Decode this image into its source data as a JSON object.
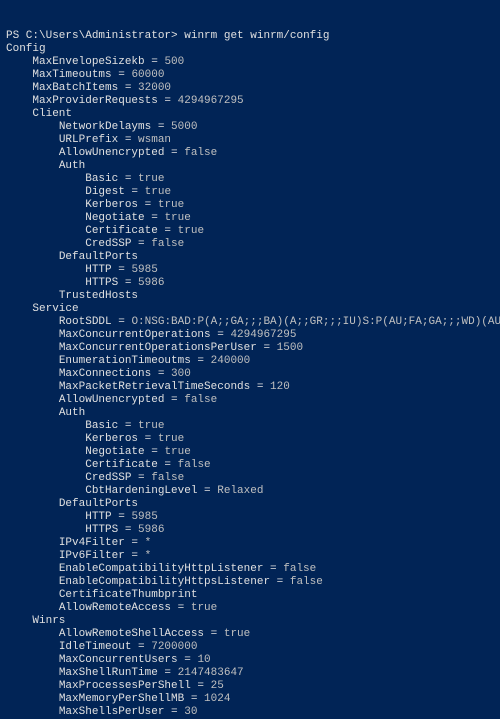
{
  "prompt": "PS C:\\Users\\Administrator>",
  "command": "winrm get winrm/config",
  "root": "Config",
  "config": {
    "MaxEnvelopeSizekb": "500",
    "MaxTimeoutms": "60000",
    "MaxBatchItems": "32000",
    "MaxProviderRequests": "4294967295"
  },
  "client_label": "Client",
  "client": {
    "NetworkDelayms": "5000",
    "URLPrefix": "wsman",
    "AllowUnencrypted": "false"
  },
  "client_auth_label": "Auth",
  "client_auth": {
    "Basic": "true",
    "Digest": "true",
    "Kerberos": "true",
    "Negotiate": "true",
    "Certificate": "true",
    "CredSSP": "false"
  },
  "client_ports_label": "DefaultPorts",
  "client_ports": {
    "HTTP": "5985",
    "HTTPS": "5986"
  },
  "client_trusted_label": "TrustedHosts",
  "service_label": "Service",
  "service": {
    "RootSDDL": "O:NSG:BAD:P(A;;GA;;;BA)(A;;GR;;;IU)S:P(AU;FA;GA;;;WD)(AU;SA;GXGW;;;WD)",
    "MaxConcurrentOperations": "4294967295",
    "MaxConcurrentOperationsPerUser": "1500",
    "EnumerationTimeoutms": "240000",
    "MaxConnections": "300",
    "MaxPacketRetrievalTimeSeconds": "120",
    "AllowUnencrypted": "false"
  },
  "service_auth_label": "Auth",
  "service_auth": {
    "Basic": "true",
    "Kerberos": "true",
    "Negotiate": "true",
    "Certificate": "false",
    "CredSSP": "false",
    "CbtHardeningLevel": "Relaxed"
  },
  "service_ports_label": "DefaultPorts",
  "service_ports": {
    "HTTP": "5985",
    "HTTPS": "5986"
  },
  "service_tail": {
    "IPv4Filter": "*",
    "IPv6Filter": "*",
    "EnableCompatibilityHttpListener": "false",
    "EnableCompatibilityHttpsListener": "false",
    "CertificateThumbprint": "",
    "AllowRemoteAccess": "true"
  },
  "winrs_label": "Winrs",
  "winrs": {
    "AllowRemoteShellAccess": "true",
    "IdleTimeout": "7200000",
    "MaxConcurrentUsers": "10",
    "MaxShellRunTime": "2147483647",
    "MaxProcessesPerShell": "25",
    "MaxMemoryPerShellMB": "1024",
    "MaxShellsPerUser": "30"
  }
}
